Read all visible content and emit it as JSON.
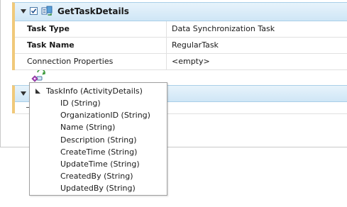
{
  "task_card": {
    "title": "GetTaskDetails",
    "checked": true,
    "rows": [
      {
        "key": "Task Type",
        "value": "Data Synchronization Task"
      },
      {
        "key": "Task Name",
        "value": "RegularTask"
      },
      {
        "key": "Connection Properties",
        "value": "<empty>"
      }
    ]
  },
  "field_popup": {
    "root_label": "TaskInfo (ActivityDetails)",
    "items": [
      "ID (String)",
      "OrganizationID (String)",
      "Name (String)",
      "Description (String)",
      "CreateTime (String)",
      "UpdateTime (String)",
      "CreatedBy (String)",
      "UpdatedBy (String)"
    ]
  },
  "colors": {
    "header_bg": "#cfe6f6",
    "header_border": "#a9cfe8",
    "accent_left": "#f0c97a"
  }
}
